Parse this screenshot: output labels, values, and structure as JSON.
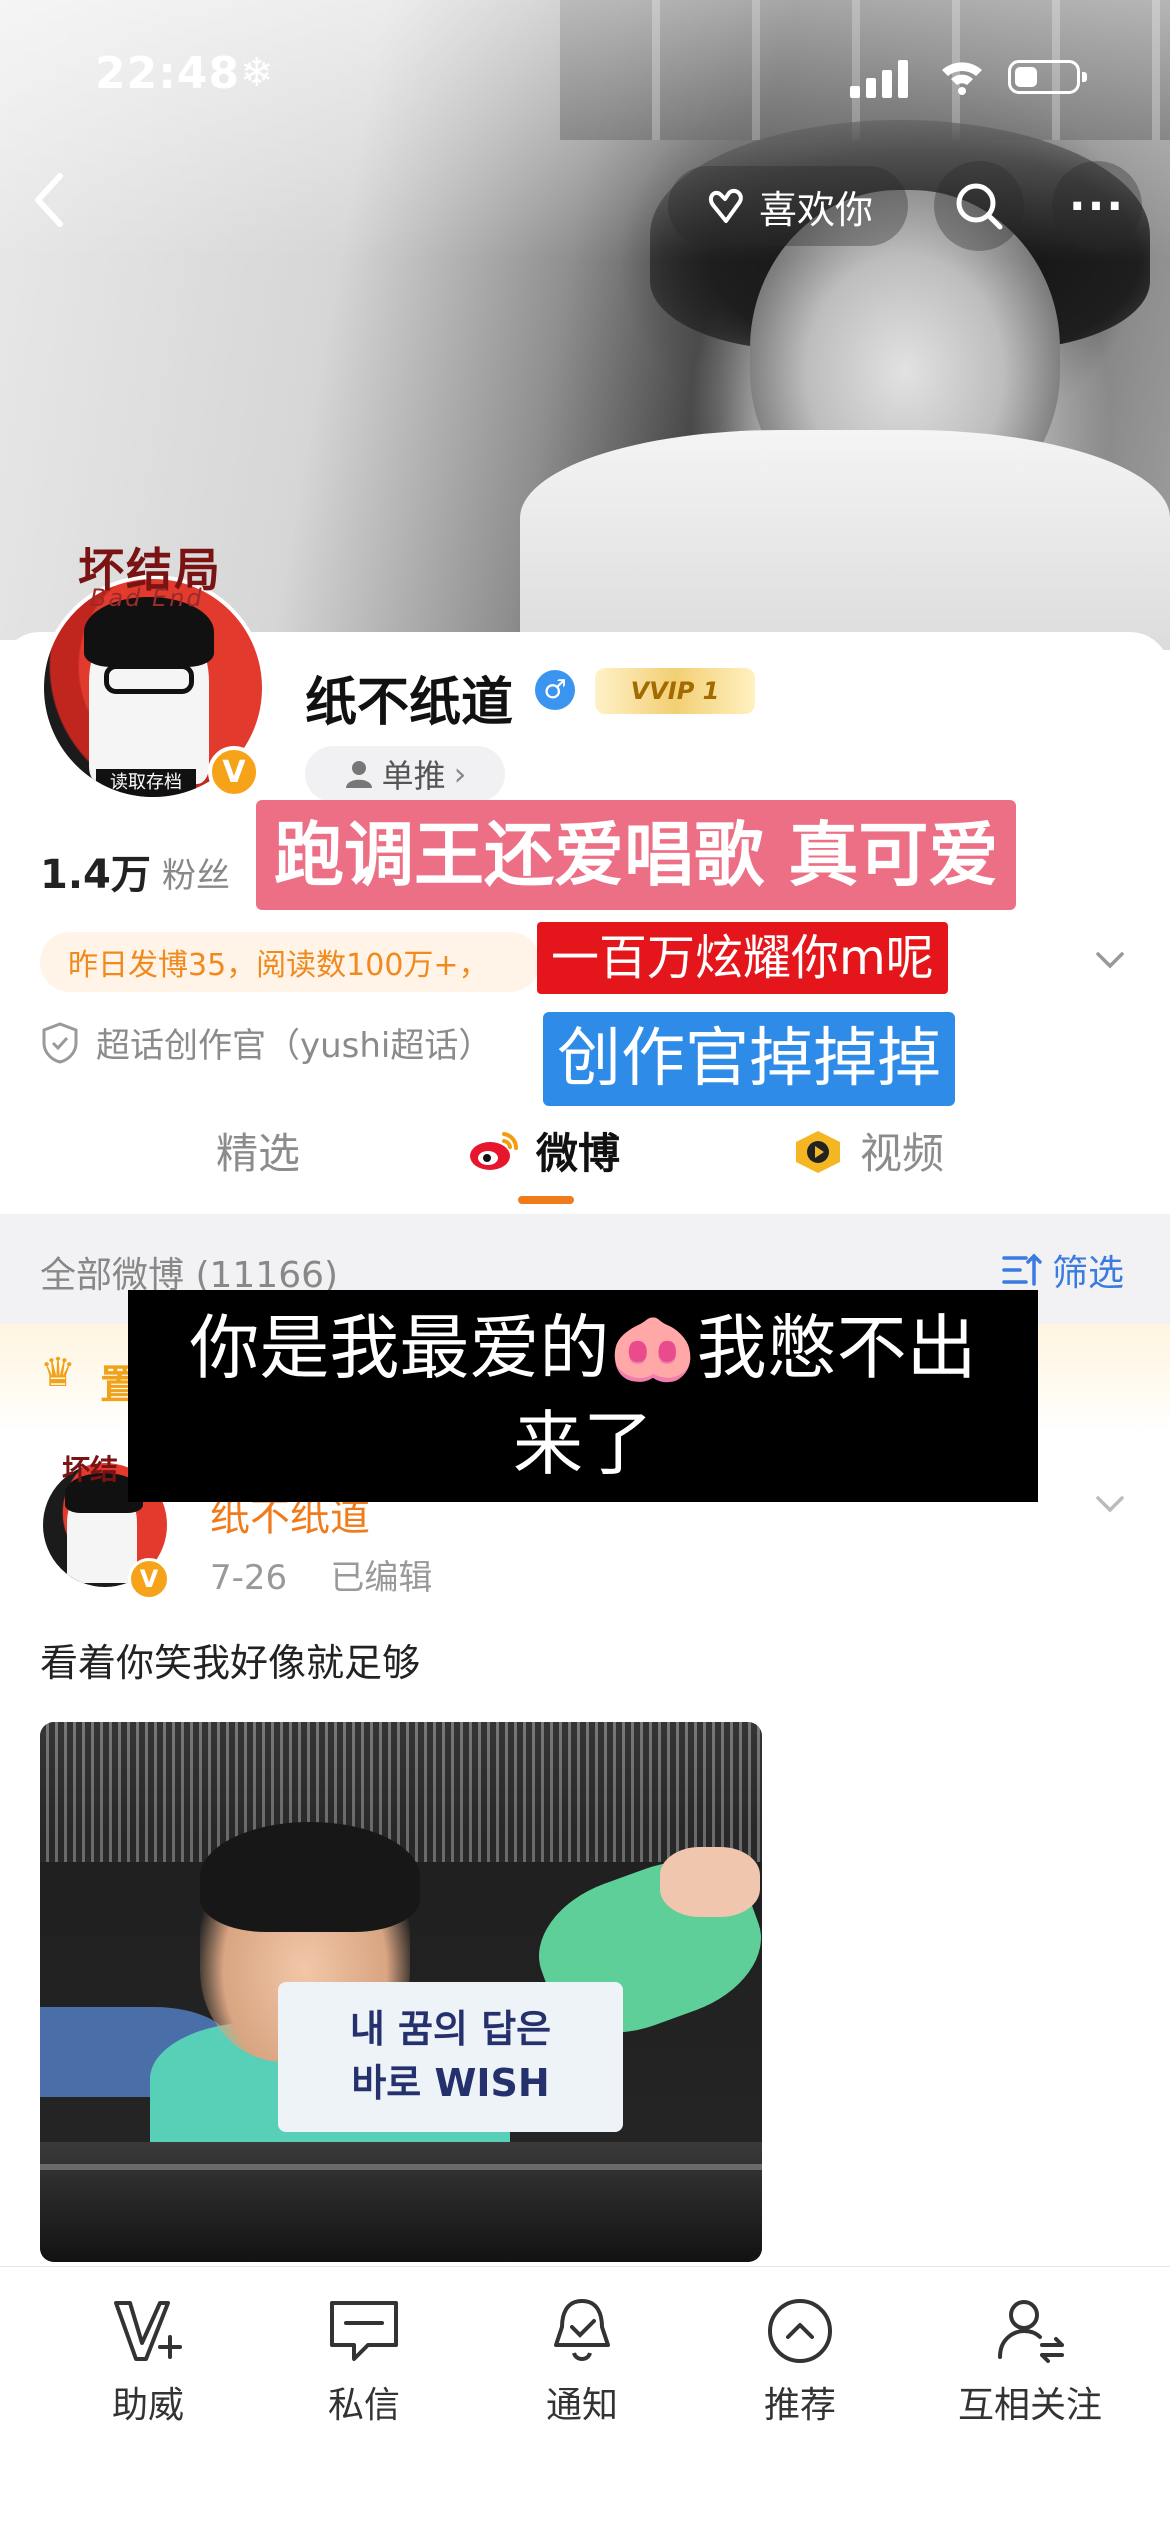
{
  "status_bar": {
    "time": "22:48",
    "weather_icon": "snowflake-icon"
  },
  "header": {
    "like_label": "喜欢你"
  },
  "profile": {
    "avatar_title": "坏结局",
    "avatar_subtitle": "Bad End",
    "avatar_tag": "读取存档",
    "username": "纸不纸道",
    "vvip_label": "VVIP 1",
    "danjui_label": "单推",
    "fans_count": "1.4万",
    "fans_label": "粉丝",
    "stats_text": "昨日发博35，阅读数100万+，",
    "topic_text": "超话创作官（yushi超话）"
  },
  "captions": {
    "pink": "跑调王还爱唱歌 真可爱",
    "red": "一百万炫耀你m呢",
    "blue": "创作官掉掉掉",
    "black_line1": "你是我最爱的🐽我憋不出",
    "black_line2": "来了"
  },
  "tabs": [
    {
      "label": "精选"
    },
    {
      "label": "微博"
    },
    {
      "label": "视频"
    }
  ],
  "feed": {
    "count_text": "全部微博 (11166)",
    "filter_label": "筛选",
    "pinned_label": "置"
  },
  "post": {
    "avatar_title": "坏结",
    "username": "纸不纸道",
    "date": "7-26",
    "edited": "已编辑",
    "text": "看着你笑我好像就足够",
    "sign_line1": "내 꿈의 답은",
    "sign_line2": "바로 WISH"
  },
  "tabbar": [
    {
      "label": "助威",
      "icon": "cheer-v-icon"
    },
    {
      "label": "私信",
      "icon": "message-icon"
    },
    {
      "label": "通知",
      "icon": "bell-icon"
    },
    {
      "label": "推荐",
      "icon": "recommend-icon"
    },
    {
      "label": "互相关注",
      "icon": "mutual-follow-icon"
    }
  ],
  "colors": {
    "accent_orange": "#f07b1b",
    "link_blue": "#3b7be0",
    "vip_gold": "#f7a31a"
  }
}
